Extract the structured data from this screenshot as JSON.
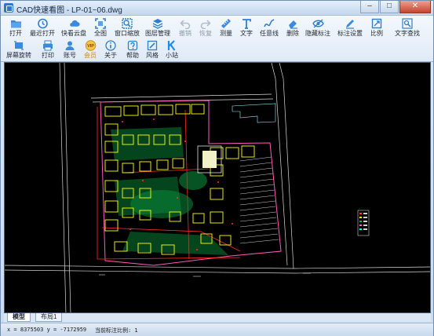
{
  "window": {
    "title": "CAD快速看图 - LP-01~06.dwg",
    "controls": {
      "minimize": "–",
      "maximize": "□",
      "close": "✕"
    }
  },
  "toolbar": {
    "row1": [
      {
        "id": "open",
        "label": "打开",
        "icon": "folder-icon"
      },
      {
        "id": "recent",
        "label": "最近打开",
        "icon": "history-icon"
      },
      {
        "id": "cloud",
        "label": "快看云盘",
        "icon": "cloud-icon"
      },
      {
        "id": "fullview",
        "label": "全图",
        "icon": "fit-screen-icon"
      },
      {
        "id": "window-zoom",
        "label": "窗口缩放",
        "icon": "zoom-window-icon"
      },
      {
        "id": "layers",
        "label": "图层管理",
        "icon": "layers-icon"
      },
      {
        "id": "undo",
        "label": "撤销",
        "icon": "undo-icon",
        "disabled": true
      },
      {
        "id": "redo",
        "label": "恢复",
        "icon": "redo-icon",
        "disabled": true
      },
      {
        "id": "measure",
        "label": "测量",
        "icon": "measure-icon"
      },
      {
        "id": "text",
        "label": "文字",
        "icon": "text-icon"
      },
      {
        "id": "freeline",
        "label": "任意线",
        "icon": "freeline-icon"
      },
      {
        "id": "delete",
        "label": "删除",
        "icon": "eraser-icon"
      },
      {
        "id": "hide-markup",
        "label": "隐藏标注",
        "icon": "eye-icon"
      },
      {
        "id": "markup-settings",
        "label": "标注设置",
        "icon": "markup-settings-icon"
      },
      {
        "id": "scale",
        "label": "比例",
        "icon": "scale-icon"
      },
      {
        "id": "text-search",
        "label": "文字查找",
        "icon": "text-search-icon"
      }
    ],
    "row2": [
      {
        "id": "rotate",
        "label": "屏幕旋转",
        "icon": "rotate-screen-icon"
      },
      {
        "id": "print",
        "label": "打印",
        "icon": "print-icon"
      },
      {
        "id": "account",
        "label": "账号",
        "icon": "user-icon"
      },
      {
        "id": "vip",
        "label": "会员",
        "icon": "vip-icon",
        "badge": "VIP"
      },
      {
        "id": "about",
        "label": "关于",
        "icon": "info-icon"
      },
      {
        "id": "help",
        "label": "帮助",
        "icon": "help-icon"
      },
      {
        "id": "style",
        "label": "风格",
        "icon": "style-icon"
      },
      {
        "id": "mini",
        "label": "小站",
        "icon": "k-logo-icon"
      }
    ]
  },
  "layout_tabs": [
    {
      "label": "模型",
      "active": true
    },
    {
      "label": "布局1",
      "active": false
    }
  ],
  "status": {
    "coords": "x = 8375503  y = -7172959",
    "scale_label": "当前标注比例: 1"
  },
  "colors": {
    "canvas_bg": "#000000",
    "cad_yellow": "#ffff00",
    "cad_green": "#00b050",
    "cad_white": "#e8e8e8",
    "cad_red": "#ff2a2a",
    "cad_pink": "#ff66cc",
    "cad_cyan": "#00ffff"
  }
}
